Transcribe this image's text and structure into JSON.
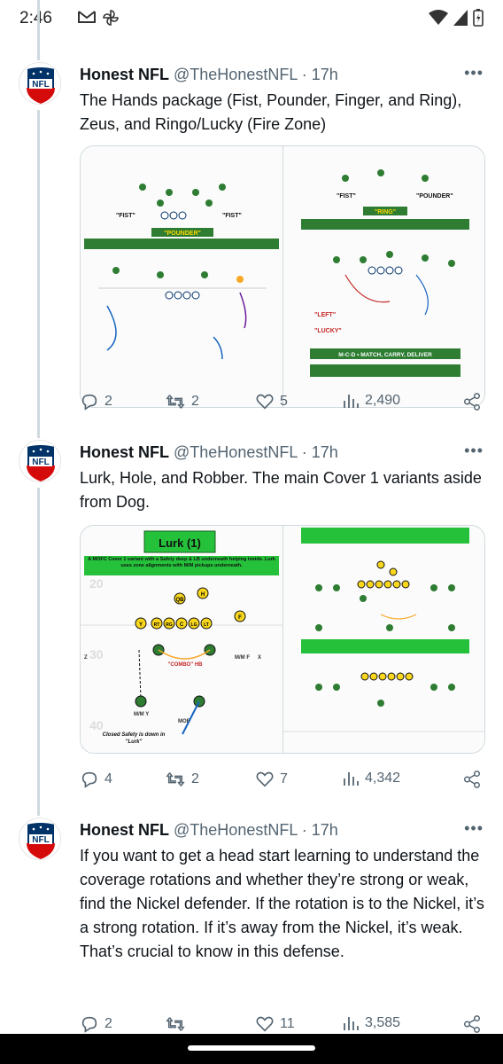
{
  "status_bar": {
    "time": "2:46"
  },
  "colors": {
    "text": "#0f1419",
    "secondary": "#536471",
    "thread_line": "#cfd9de",
    "field_green": "#2e7d32",
    "label_green": "#25c13b"
  },
  "tweets": [
    {
      "name": "Honest NFL",
      "handle": "@TheHonestNFL",
      "separator": "·",
      "time": "17h",
      "text": "The Hands package (Fist, Pounder, Finger, and Ring), Zeus, and Ringo/Lucky (Fire Zone)",
      "media": {
        "left": {
          "labels": [
            "\"FIST\"",
            "\"FIST\"",
            "\"POUNDER\""
          ]
        },
        "right": {
          "labels": [
            "\"FIST\"",
            "\"POUNDER\"",
            "\"RING\"",
            "\"LEFT\"",
            "\"LUCKY\"",
            "M-C-D • MATCH, CARRY, DELIVER"
          ]
        }
      },
      "stats": {
        "replies": "2",
        "retweets": "2",
        "likes": "5",
        "views": "2,490"
      }
    },
    {
      "name": "Honest NFL",
      "handle": "@TheHonestNFL",
      "separator": "·",
      "time": "17h",
      "text": "Lurk, Hole, and Robber. The main Cover 1 variants aside from Dog.",
      "media": {
        "left": {
          "title": "Lurk (1)",
          "description": "A MOFC Cover 1 variant with a Safety deep & LB underneath helping inside. Lurk uses zone alignments with M/M pickups underneath.",
          "yard_labels": [
            "20",
            "30",
            "40"
          ],
          "player_labels": [
            "QB",
            "H",
            "Y",
            "RT",
            "RG",
            "C",
            "LG",
            "LT",
            "F",
            "X",
            "Z"
          ],
          "combo_label": "\"COMBO\" HB",
          "mm_f": "M/M F",
          "mm_y": "M/M Y",
          "mof": "MOF",
          "closed_safety": "Closed Safety is down in \"Lurk\""
        }
      },
      "stats": {
        "replies": "4",
        "retweets": "2",
        "likes": "7",
        "views": "4,342"
      }
    },
    {
      "name": "Honest NFL",
      "handle": "@TheHonestNFL",
      "separator": "·",
      "time": "17h",
      "text": "If you want to get a head start learning to understand the coverage rotations and whether they’re strong or weak, find the Nickel defender. If the rotation is to the Nickel, it’s a strong rotation. If it’s away from the Nickel, it’s weak. That’s crucial to know in this defense.",
      "stats": {
        "replies": "2",
        "retweets": "",
        "likes": "11",
        "views": "3,585"
      }
    }
  ]
}
